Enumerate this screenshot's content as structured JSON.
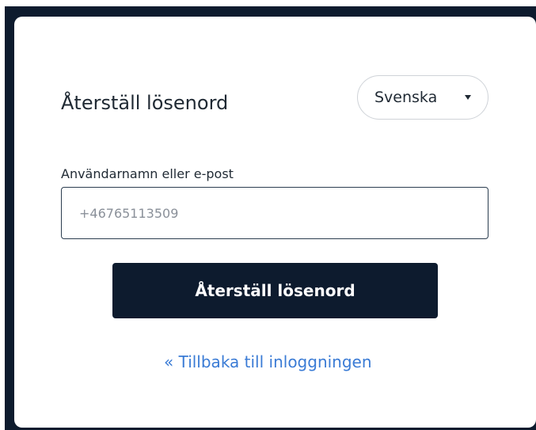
{
  "page": {
    "title": "Återställ lösenord"
  },
  "language": {
    "selected": "Svenska"
  },
  "form": {
    "username_label": "Användarnamn eller e-post",
    "username_placeholder": "+46765113509",
    "submit_label": "Återställ lösenord"
  },
  "links": {
    "back_to_login": "« Tillbaka till inloggningen"
  },
  "colors": {
    "frame": "#0d1b2e",
    "card": "#ffffff",
    "button": "#0d1b2e",
    "button_text": "#ffffff",
    "link": "#3a7bd5",
    "text": "#1f2933",
    "input_border": "#2c3e50"
  },
  "icons": {
    "language_dropdown": "caret-down-icon"
  }
}
